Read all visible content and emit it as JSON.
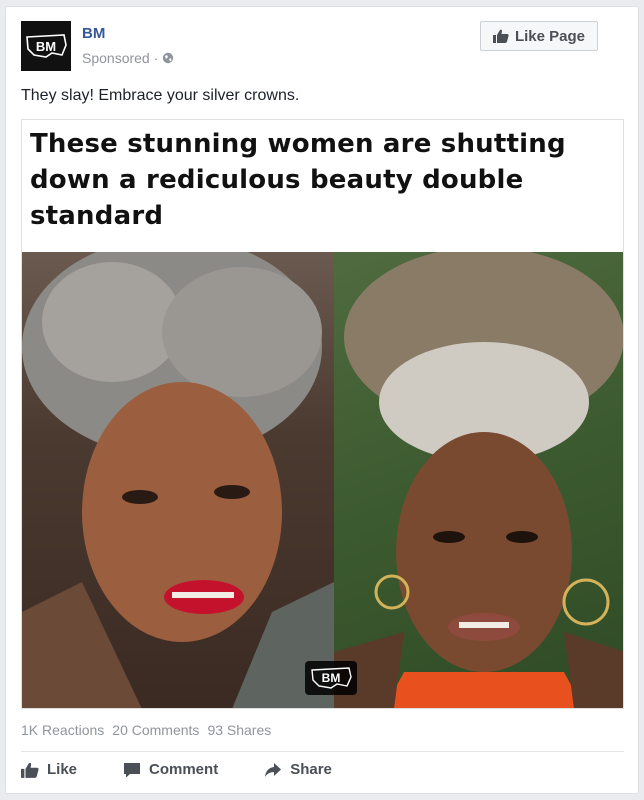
{
  "header": {
    "logo_text": "BM",
    "page_name": "BM",
    "sponsored": "Sponsored",
    "separator": "·",
    "like_page_label": "Like Page"
  },
  "post": {
    "text": "They slay! Embrace your silver crowns.",
    "headline": "These stunning women are shutting down a rediculous beauty double standard",
    "watermark_text": "BM"
  },
  "stats": {
    "reactions": "1K Reactions",
    "comments": "20 Comments",
    "shares": "93 Shares"
  },
  "actions": {
    "like": "Like",
    "comment": "Comment",
    "share": "Share"
  },
  "colors": {
    "link_blue": "#365899",
    "meta_gray": "#90949c",
    "action_gray": "#4b4f56"
  }
}
